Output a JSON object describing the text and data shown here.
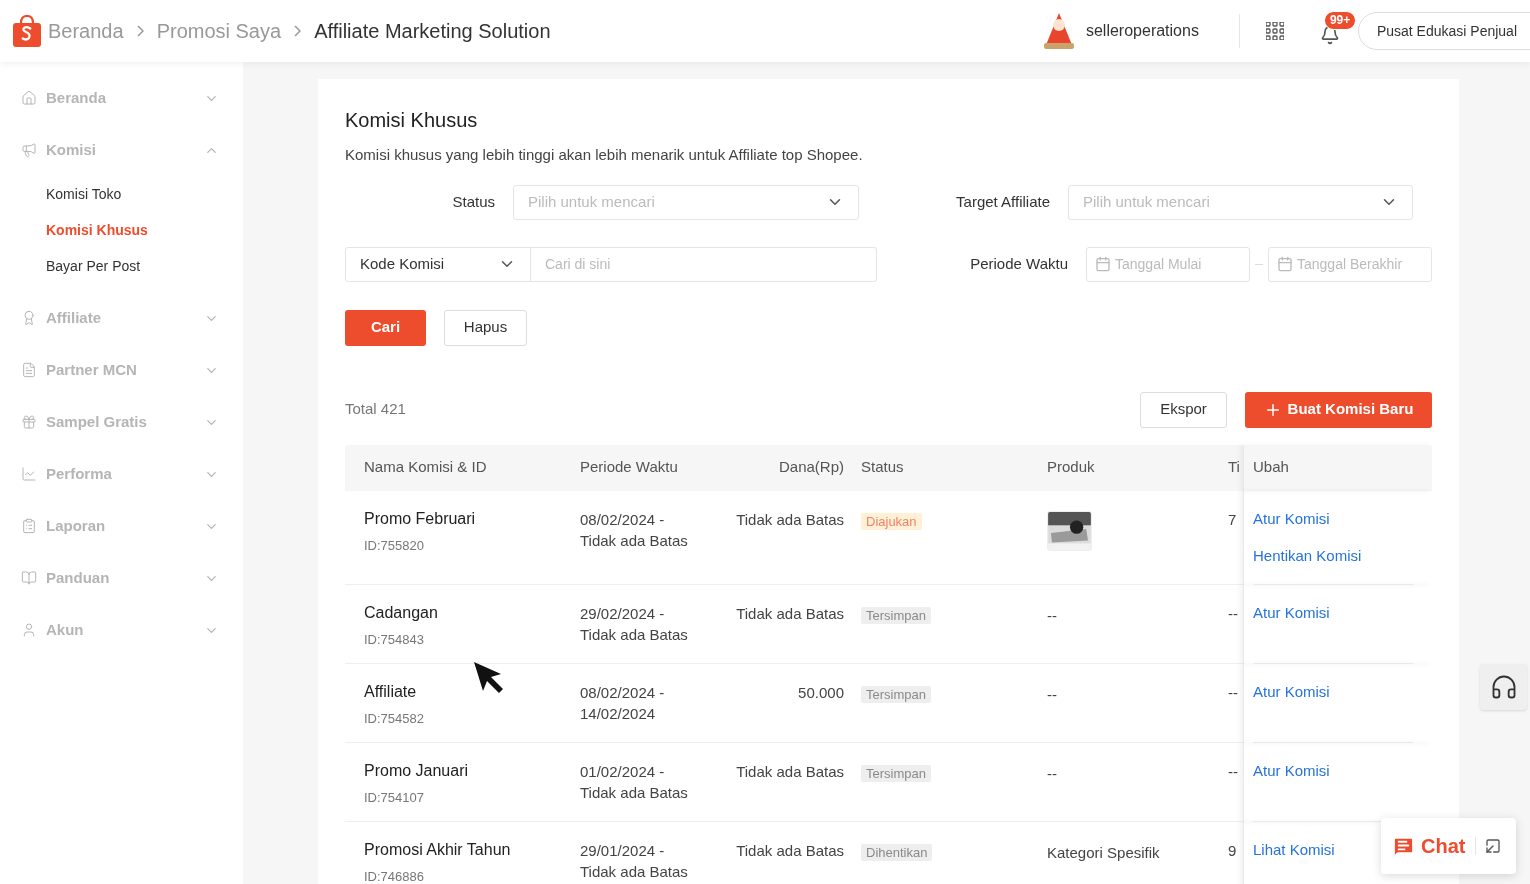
{
  "header": {
    "breadcrumb": [
      "Beranda",
      "Promosi Saya",
      "Affiliate Marketing Solution"
    ],
    "username": "selleroperations",
    "notification_badge": "99+",
    "edu_button": "Pusat Edukasi Penjual"
  },
  "sidebar": {
    "items": [
      {
        "label": "Beranda",
        "expanded": false
      },
      {
        "label": "Komisi",
        "expanded": true,
        "children": [
          {
            "label": "Komisi Toko",
            "selected": false
          },
          {
            "label": "Komisi Khusus",
            "selected": true
          },
          {
            "label": "Bayar Per Post",
            "selected": false
          }
        ]
      },
      {
        "label": "Affiliate",
        "expanded": false
      },
      {
        "label": "Partner MCN",
        "expanded": false
      },
      {
        "label": "Sampel Gratis",
        "expanded": false
      },
      {
        "label": "Performa",
        "expanded": false
      },
      {
        "label": "Laporan",
        "expanded": false
      },
      {
        "label": "Panduan",
        "expanded": false
      },
      {
        "label": "Akun",
        "expanded": false
      }
    ]
  },
  "page": {
    "title": "Komisi Khusus",
    "description": "Komisi khusus yang lebih tinggi akan lebih menarik untuk Affiliate top Shopee."
  },
  "filters": {
    "status_label": "Status",
    "status_placeholder": "Pilih untuk mencari",
    "target_label": "Target Affiliate",
    "target_placeholder": "Pilih untuk mencari",
    "code_select": "Kode Komisi",
    "search_placeholder": "Cari di sini",
    "period_label": "Periode Waktu",
    "start_placeholder": "Tanggal Mulai",
    "end_placeholder": "Tanggal Berakhir",
    "search_button": "Cari",
    "clear_button": "Hapus"
  },
  "toolbar": {
    "total": "Total 421",
    "export_button": "Ekspor",
    "create_button": "Buat Komisi Baru"
  },
  "table": {
    "columns": [
      "Nama Komisi & ID",
      "Periode Waktu",
      "Dana(Rp)",
      "Status",
      "Produk",
      "Ti",
      "Ubah"
    ],
    "rows": [
      {
        "name": "Promo Februari",
        "id": "ID:755820",
        "period": [
          "08/02/2024 -",
          "Tidak ada Batas"
        ],
        "fund": "Tidak ada Batas",
        "status": {
          "text": "Diajukan",
          "kind": "pending"
        },
        "product": {
          "kind": "picture"
        },
        "column_6": "7",
        "actions": [
          "Atur Komisi",
          "Hentikan Komisi"
        ]
      },
      {
        "name": "Cadangan",
        "id": "ID:754843",
        "period": [
          "29/02/2024 -",
          "Tidak ada Batas"
        ],
        "fund": "Tidak ada Batas",
        "status": {
          "text": "Tersimpan",
          "kind": "saved"
        },
        "product": {
          "kind": "text",
          "text": "--"
        },
        "column_6": "--",
        "actions": [
          "Atur Komisi"
        ]
      },
      {
        "name": "Affiliate",
        "id": "ID:754582",
        "period": [
          "08/02/2024 -",
          "14/02/2024"
        ],
        "fund": "50.000",
        "status": {
          "text": "Tersimpan",
          "kind": "saved"
        },
        "product": {
          "kind": "text",
          "text": "--"
        },
        "column_6": "--",
        "actions": [
          "Atur Komisi"
        ]
      },
      {
        "name": "Promo Januari",
        "id": "ID:754107",
        "period": [
          "01/02/2024 -",
          "Tidak ada Batas"
        ],
        "fund": "Tidak ada Batas",
        "status": {
          "text": "Tersimpan",
          "kind": "saved"
        },
        "product": {
          "kind": "text",
          "text": "--"
        },
        "column_6": "--",
        "actions": [
          "Atur Komisi"
        ]
      },
      {
        "name": "Promosi Akhir Tahun",
        "id": "ID:746886",
        "period": [
          "29/01/2024 -",
          "Tidak ada Batas"
        ],
        "fund": "Tidak ada Batas",
        "status": {
          "text": "Dihentikan",
          "kind": "stopped"
        },
        "product": {
          "kind": "text",
          "text": "Kategori Spesifik"
        },
        "column_6": "9",
        "actions": [
          "Lihat Komisi"
        ]
      }
    ]
  },
  "chat": {
    "label": "Chat"
  }
}
